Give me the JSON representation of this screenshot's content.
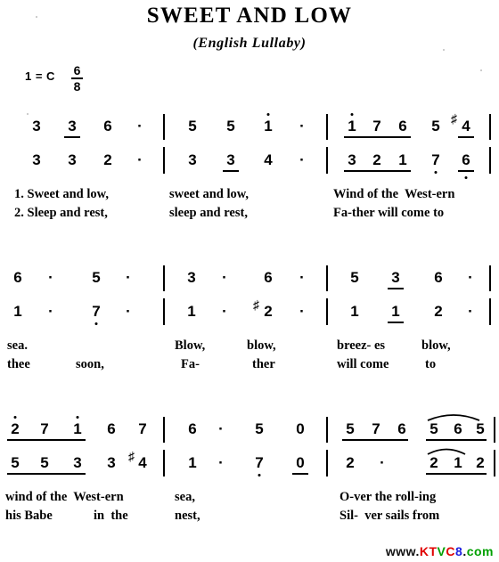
{
  "header": {
    "title": "SWEET AND LOW",
    "subtitle": "(English Lullaby)",
    "key_signature": "1 = C",
    "time_signature_numerator": "6",
    "time_signature_denominator": "8"
  },
  "watermark": {
    "www": "www.",
    "k": "K",
    "t": "T",
    "v": "V",
    "c": "C",
    "eight": "8",
    "dot": ".",
    "com": "com",
    "full": "www.KTVC8.com",
    "colors": {
      "red": "#e00000",
      "green": "#00a000",
      "blue": "#2020e0",
      "black": "#111111"
    }
  },
  "chart_data": {
    "type": "table",
    "title": "SWEET AND LOW",
    "subtitle": "(English Lullaby)",
    "notation": "jianpu numbered musical notation, two voices (upper / lower), 6/8 time, key of C",
    "systems": [
      {
        "index": 1,
        "measures": [
          {
            "upper": [
              "3",
              "3",
              "6",
              "·"
            ],
            "lower": [
              "3",
              "3",
              "2",
              "·"
            ],
            "upper_beams": [
              false,
              true,
              false,
              false
            ],
            "lower_beams": [
              false,
              false,
              false,
              false
            ]
          },
          {
            "upper": [
              "5",
              "5",
              "1",
              "·"
            ],
            "lower": [
              "3",
              "3",
              "4",
              "·"
            ],
            "upper_octave_up": [
              false,
              false,
              true,
              false
            ],
            "lower_beams": [
              false,
              true,
              false,
              false
            ]
          },
          {
            "upper": [
              "1",
              "7",
              "6",
              "5",
              "4"
            ],
            "lower": [
              "3",
              "2",
              "1",
              "7",
              "6"
            ],
            "upper_octave_up": [
              true,
              false,
              false,
              false,
              false
            ],
            "upper_sharp": [
              false,
              false,
              false,
              false,
              true
            ],
            "lower_octave_down": [
              false,
              false,
              false,
              true,
              true
            ],
            "upper_beam_group": "1 7 6",
            "lower_beam_group": "3 2 1"
          }
        ],
        "lyrics_line1": [
          "1. Sweet and low,",
          "sweet and low,",
          "Wind of the  West-ern"
        ],
        "lyrics_line2": [
          "2. Sleep and rest,",
          "sleep and rest,",
          "Fa-ther will come to"
        ]
      },
      {
        "index": 2,
        "measures": [
          {
            "upper": [
              "6",
              "·",
              "5",
              "·"
            ],
            "lower": [
              "1",
              "·",
              "7",
              "·"
            ],
            "lower_octave_down": [
              false,
              false,
              true,
              false
            ]
          },
          {
            "upper": [
              "3",
              "·",
              "6",
              "·"
            ],
            "lower": [
              "1",
              "·",
              "2",
              "·"
            ],
            "lower_sharp": [
              false,
              false,
              true,
              false
            ]
          },
          {
            "upper": [
              "5",
              "3",
              "6",
              "·"
            ],
            "lower": [
              "1",
              "1",
              "2",
              "·"
            ],
            "upper_beams": [
              false,
              true,
              false,
              false
            ],
            "lower_beams": [
              false,
              true,
              false,
              false
            ]
          }
        ],
        "lyrics_line1": [
          "sea.",
          "Blow,",
          "blow,",
          "breez- es",
          "blow,"
        ],
        "lyrics_line2": [
          "thee",
          "soon,",
          "Fa-",
          "ther",
          "will come",
          "to"
        ]
      },
      {
        "index": 3,
        "measures": [
          {
            "upper": [
              "2",
              "7",
              "1",
              "6",
              "7"
            ],
            "lower": [
              "5",
              "5",
              "3",
              "3",
              "4"
            ],
            "upper_octave_up": [
              true,
              false,
              true,
              false,
              false
            ],
            "lower_sharp": [
              false,
              false,
              false,
              false,
              true
            ],
            "upper_beam_group": "2 7 1",
            "lower_beam_group": "5 5 3"
          },
          {
            "upper": [
              "6",
              "·",
              "5",
              "0"
            ],
            "lower": [
              "1",
              "·",
              "7",
              "0"
            ],
            "lower_octave_down": [
              false,
              false,
              true,
              false
            ],
            "lower_beams": [
              false,
              false,
              false,
              true
            ]
          },
          {
            "upper": [
              "5",
              "7",
              "6",
              "5",
              "6",
              "5"
            ],
            "lower": [
              "2",
              "·",
              "2",
              "1",
              "2"
            ],
            "upper_beam_group_1": "5 7 6",
            "upper_beam_group_2": "5 6 5",
            "upper_slur": "5 6 5",
            "lower_beam_group": "2 1 2",
            "lower_slur": "2 1"
          }
        ],
        "lyrics_line1": [
          "wind of the  West-ern",
          "sea,",
          "O-ver the roll-ing"
        ],
        "lyrics_line2": [
          "his Babe",
          "in  the",
          "nest,",
          "Sil-  ver sails from"
        ]
      }
    ]
  },
  "systems": [
    {
      "upper_notes": [
        "3",
        "3",
        "6",
        "·",
        "5",
        "5",
        "1",
        "·",
        "1",
        "7",
        "6",
        "5",
        "4"
      ],
      "lower_notes": [
        "3",
        "3",
        "2",
        "·",
        "3",
        "3",
        "4",
        "·",
        "3",
        "2",
        "1",
        "7",
        "6"
      ],
      "lyric1": [
        "1. Sweet and low,",
        "sweet and low,",
        "Wind of the  West-ern"
      ],
      "lyric2": [
        "2. Sleep and rest,",
        "sleep and rest,",
        "Fa-ther will come to"
      ]
    },
    {
      "upper_notes": [
        "6",
        "·",
        "5",
        "·",
        "3",
        "·",
        "6",
        "·",
        "5",
        "3",
        "6",
        "·"
      ],
      "lower_notes": [
        "1",
        "·",
        "7",
        "·",
        "1",
        "·",
        "2",
        "·",
        "1",
        "1",
        "2",
        "·"
      ],
      "lyric1": [
        "sea.",
        "Blow,",
        "blow,",
        "breez- es",
        "blow,"
      ],
      "lyric2": [
        "thee",
        "soon,",
        "Fa-",
        "ther",
        "will come",
        "to"
      ]
    },
    {
      "upper_notes": [
        "2",
        "7",
        "1",
        "6",
        "7",
        "6",
        "·",
        "5",
        "0",
        "5",
        "7",
        "6",
        "5",
        "6",
        "5"
      ],
      "lower_notes": [
        "5",
        "5",
        "3",
        "3",
        "4",
        "1",
        "·",
        "7",
        "0",
        "2",
        "·",
        "2",
        "1",
        "2"
      ],
      "lyric1": [
        "wind of the  West-ern",
        "sea,",
        "O-ver the roll-ing"
      ],
      "lyric2": [
        "his Babe",
        "in  the",
        "nest,",
        "Sil-  ver sails from"
      ]
    }
  ]
}
